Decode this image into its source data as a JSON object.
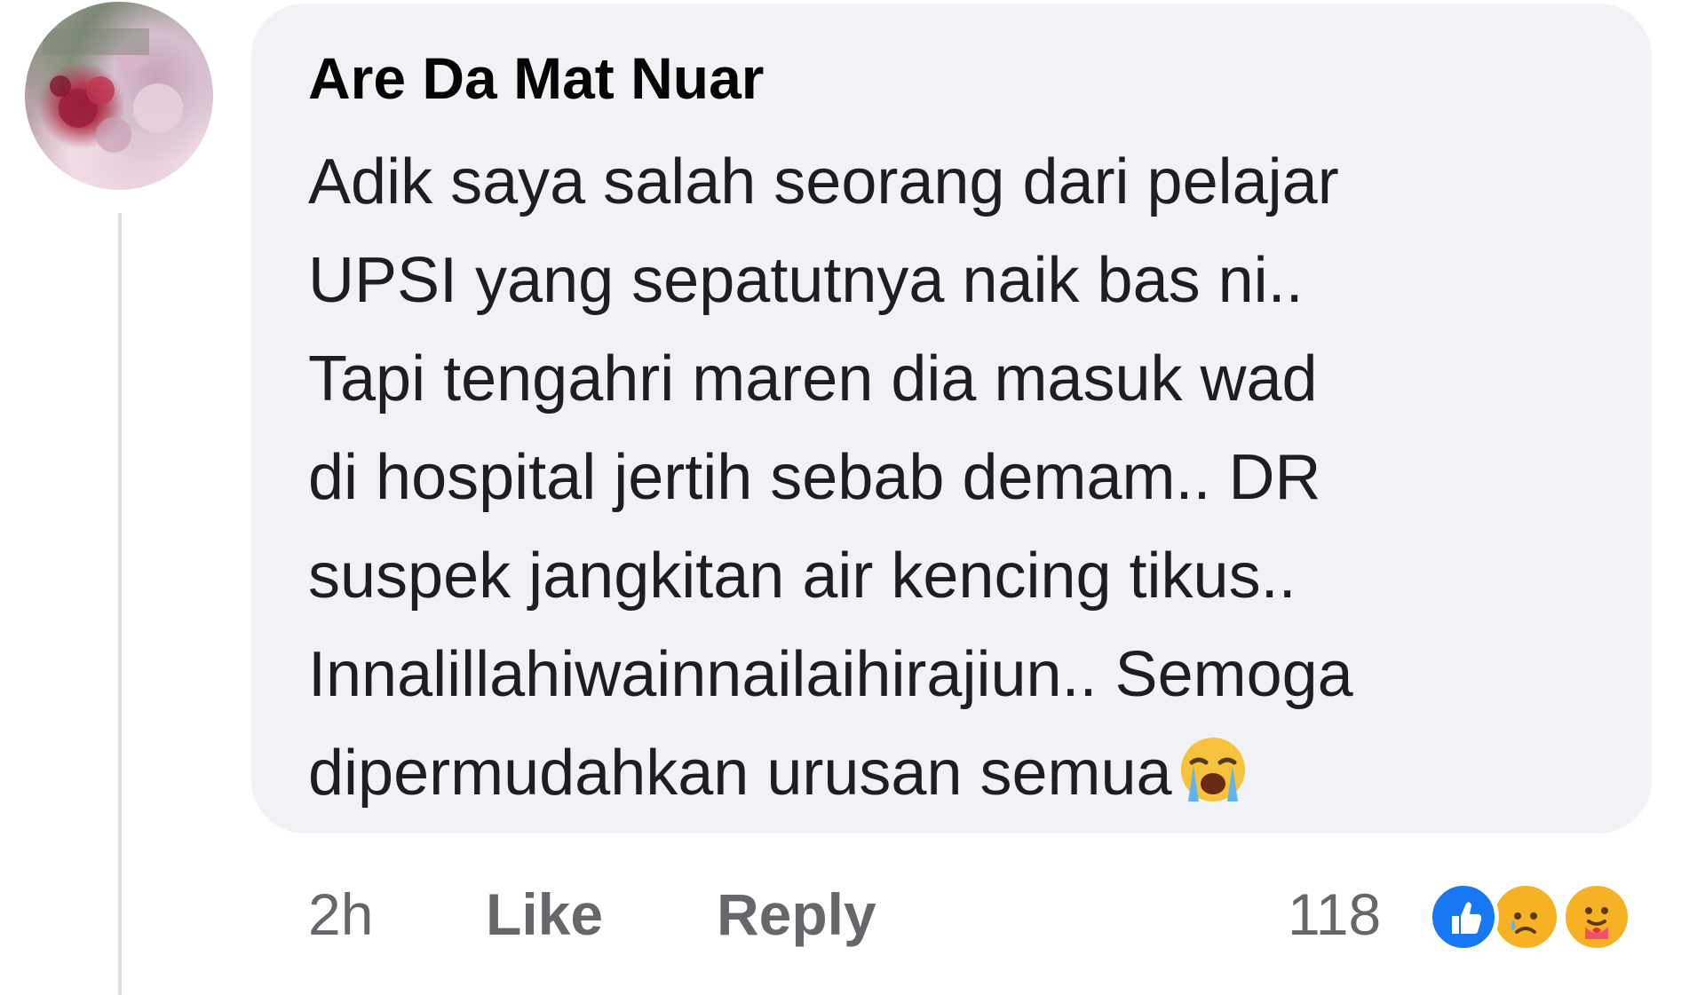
{
  "comment": {
    "author": "Are Da Mat Nuar",
    "lines": [
      "Adik saya salah seorang dari pelajar",
      "UPSI yang sepatutnya naik bas ni..",
      "Tapi tengahri maren dia masuk wad",
      "di hospital jertih sebab demam.. DR",
      "suspek jangkitan air kencing tikus..",
      "Innalillahiwainnailaihirajiun.. Semoga",
      "dipermudahkan urusan semua"
    ],
    "trailing_emoji": "loudly-crying-face"
  },
  "actions": {
    "time": "2h",
    "like_label": "Like",
    "reply_label": "Reply"
  },
  "reactions": {
    "count": "118",
    "types": [
      "like",
      "sad",
      "care"
    ]
  },
  "colors": {
    "bubble": "#f0f2f5",
    "like_blue": "#1877f2",
    "emoji_yellow": "#f7b125",
    "meta_gray": "#65676b"
  }
}
